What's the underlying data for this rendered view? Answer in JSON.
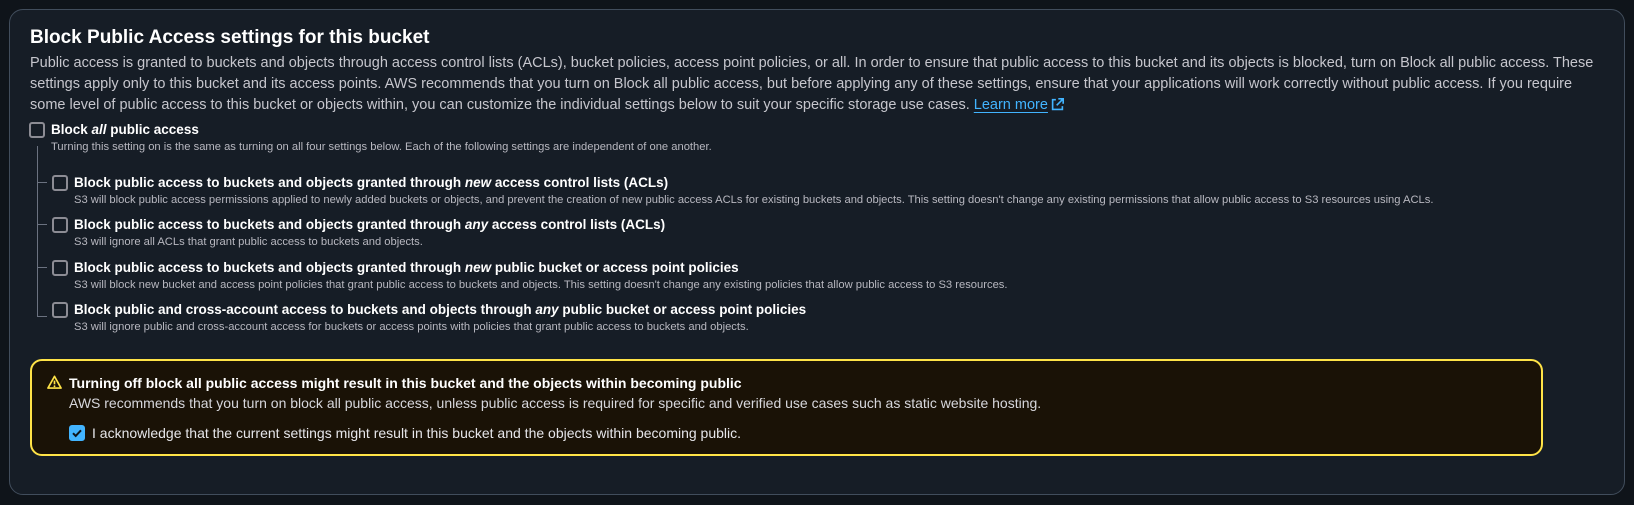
{
  "section": {
    "title": "Block Public Access settings for this bucket",
    "description": "Public access is granted to buckets and objects through access control lists (ACLs), bucket policies, access point policies, or all. In order to ensure that public access to this bucket and its objects is blocked, turn on Block all public access. These settings apply only to this bucket and its access points. AWS recommends that you turn on Block all public access, but before applying any of these settings, ensure that your applications will work correctly without public access. If you require some level of public access to this bucket or objects within, you can customize the individual settings below to suit your specific storage use cases.",
    "learn_more": "Learn more"
  },
  "block_all": {
    "label_pre": "Block ",
    "label_em": "all",
    "label_post": " public access",
    "description": "Turning this setting on is the same as turning on all four settings below. Each of the following settings are independent of one another.",
    "checked": false
  },
  "options": [
    {
      "label_pre": "Block public access to buckets and objects granted through ",
      "label_em": "new",
      "label_post": " access control lists (ACLs)",
      "description": "S3 will block public access permissions applied to newly added buckets or objects, and prevent the creation of new public access ACLs for existing buckets and objects. This setting doesn't change any existing permissions that allow public access to S3 resources using ACLs.",
      "checked": false
    },
    {
      "label_pre": "Block public access to buckets and objects granted through ",
      "label_em": "any",
      "label_post": " access control lists (ACLs)",
      "description": "S3 will ignore all ACLs that grant public access to buckets and objects.",
      "checked": false
    },
    {
      "label_pre": "Block public access to buckets and objects granted through ",
      "label_em": "new",
      "label_post": " public bucket or access point policies",
      "description": "S3 will block new bucket and access point policies that grant public access to buckets and objects. This setting doesn't change any existing policies that allow public access to S3 resources.",
      "checked": false
    },
    {
      "label_pre": "Block public and cross-account access to buckets and objects through ",
      "label_em": "any",
      "label_post": " public bucket or access point policies",
      "description": "S3 will ignore public and cross-account access for buckets or access points with policies that grant public access to buckets and objects.",
      "checked": false
    }
  ],
  "warning": {
    "icon": "warning-triangle-icon",
    "title": "Turning off block all public access might result in this bucket and the objects within becoming public",
    "text": "AWS recommends that you turn on block all public access, unless public access is required for specific and verified use cases such as static website hosting.",
    "acknowledge_label": "I acknowledge that the current settings might result in this bucket and the objects within becoming public.",
    "acknowledged": true
  },
  "colors": {
    "link": "#42b4ff",
    "warning_border": "#ffe347",
    "checkbox_checked": "#42b4ff"
  }
}
